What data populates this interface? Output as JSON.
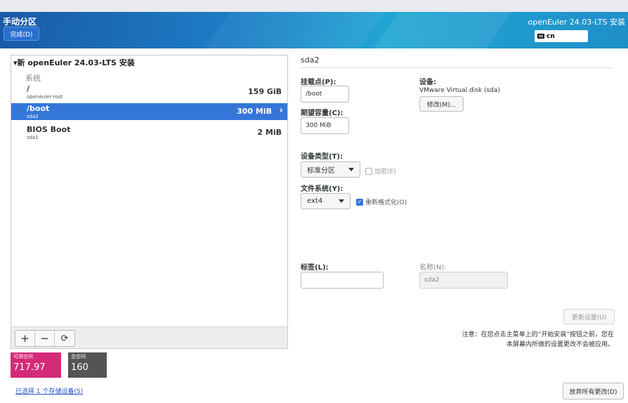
{
  "header": {
    "title": "手动分区",
    "done_label": "完成(D)",
    "product": "openEuler 24.03-LTS 安装",
    "keyboard_layout": "cn",
    "accent_color": "#1b7cc4"
  },
  "tree": {
    "title": "新 openEuler 24.03-LTS 安装",
    "section": "系统",
    "partitions": [
      {
        "mount": "/",
        "device": "openeuler-root",
        "size": "159 GiB",
        "selected": false
      },
      {
        "mount": "/boot",
        "device": "sda2",
        "size": "300 MiB",
        "selected": true
      },
      {
        "mount": "BIOS Boot",
        "device": "sda1",
        "size": "2 MiB",
        "selected": false
      }
    ],
    "toolbar": {
      "add": "+",
      "remove": "−",
      "refresh": "⟳"
    }
  },
  "space": {
    "available_label": "可用空间",
    "available_value": "717.97 MiB",
    "total_label": "总空间",
    "total_value": "160 GiB",
    "available_color": "#d42b78",
    "total_color": "#545454"
  },
  "storage_link": "已选择 1 个存储设备(S)",
  "details": {
    "header": "sda2",
    "mount_label": "挂载点(P):",
    "mount_value": "/boot",
    "capacity_label": "期望容量(C):",
    "capacity_value": "300 MiB",
    "device_label": "设备:",
    "device_value": "VMware Virtual disk (sda)",
    "modify_button": "修改(M)...",
    "device_type_label": "设备类型(T):",
    "device_type_value": "标准分区",
    "encrypt_label": "加密(E)",
    "filesystem_label": "文件系统(Y):",
    "filesystem_value": "ext4",
    "reformat_label": "重新格式化(O)",
    "tag_label": "标签(L):",
    "tag_value": "",
    "name_label": "名称(N):",
    "name_value": "sda2",
    "update_button": "更新设置(U)",
    "note_line1": "注意：在您点击主菜单上的“开始安装”按钮之前，您在",
    "note_line2": "本屏幕内所做的设置更改不会被应用。",
    "discard_button": "放弃所有更改(D)"
  }
}
